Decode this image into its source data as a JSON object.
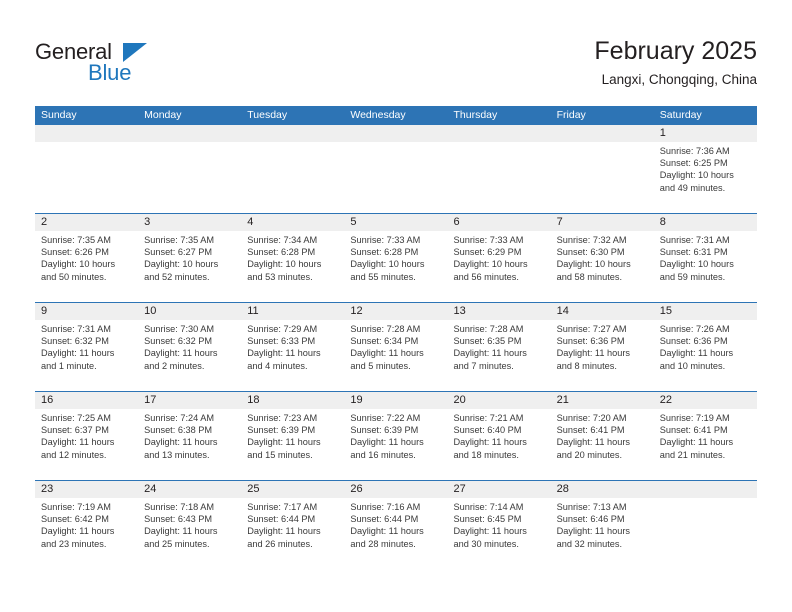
{
  "brand": {
    "name_part1": "General",
    "name_part2": "Blue",
    "accent_color": "#1f77bd"
  },
  "header": {
    "title": "February 2025",
    "subtitle": "Langxi, Chongqing, China"
  },
  "theme": {
    "header_bar": "#2d74b5",
    "daynum_band": "#efefef",
    "text": "#231f20"
  },
  "weekdays": [
    "Sunday",
    "Monday",
    "Tuesday",
    "Wednesday",
    "Thursday",
    "Friday",
    "Saturday"
  ],
  "labels": {
    "sunrise": "Sunrise:",
    "sunset": "Sunset:",
    "daylight": "Daylight:"
  },
  "weeks": [
    [
      {
        "day": "",
        "empty": true
      },
      {
        "day": "",
        "empty": true
      },
      {
        "day": "",
        "empty": true
      },
      {
        "day": "",
        "empty": true
      },
      {
        "day": "",
        "empty": true
      },
      {
        "day": "",
        "empty": true
      },
      {
        "day": "1",
        "sunrise": "Sunrise: 7:36 AM",
        "sunset": "Sunset: 6:25 PM",
        "daylight": "Daylight: 10 hours and 49 minutes."
      }
    ],
    [
      {
        "day": "2",
        "sunrise": "Sunrise: 7:35 AM",
        "sunset": "Sunset: 6:26 PM",
        "daylight": "Daylight: 10 hours and 50 minutes."
      },
      {
        "day": "3",
        "sunrise": "Sunrise: 7:35 AM",
        "sunset": "Sunset: 6:27 PM",
        "daylight": "Daylight: 10 hours and 52 minutes."
      },
      {
        "day": "4",
        "sunrise": "Sunrise: 7:34 AM",
        "sunset": "Sunset: 6:28 PM",
        "daylight": "Daylight: 10 hours and 53 minutes."
      },
      {
        "day": "5",
        "sunrise": "Sunrise: 7:33 AM",
        "sunset": "Sunset: 6:28 PM",
        "daylight": "Daylight: 10 hours and 55 minutes."
      },
      {
        "day": "6",
        "sunrise": "Sunrise: 7:33 AM",
        "sunset": "Sunset: 6:29 PM",
        "daylight": "Daylight: 10 hours and 56 minutes."
      },
      {
        "day": "7",
        "sunrise": "Sunrise: 7:32 AM",
        "sunset": "Sunset: 6:30 PM",
        "daylight": "Daylight: 10 hours and 58 minutes."
      },
      {
        "day": "8",
        "sunrise": "Sunrise: 7:31 AM",
        "sunset": "Sunset: 6:31 PM",
        "daylight": "Daylight: 10 hours and 59 minutes."
      }
    ],
    [
      {
        "day": "9",
        "sunrise": "Sunrise: 7:31 AM",
        "sunset": "Sunset: 6:32 PM",
        "daylight": "Daylight: 11 hours and 1 minute."
      },
      {
        "day": "10",
        "sunrise": "Sunrise: 7:30 AM",
        "sunset": "Sunset: 6:32 PM",
        "daylight": "Daylight: 11 hours and 2 minutes."
      },
      {
        "day": "11",
        "sunrise": "Sunrise: 7:29 AM",
        "sunset": "Sunset: 6:33 PM",
        "daylight": "Daylight: 11 hours and 4 minutes."
      },
      {
        "day": "12",
        "sunrise": "Sunrise: 7:28 AM",
        "sunset": "Sunset: 6:34 PM",
        "daylight": "Daylight: 11 hours and 5 minutes."
      },
      {
        "day": "13",
        "sunrise": "Sunrise: 7:28 AM",
        "sunset": "Sunset: 6:35 PM",
        "daylight": "Daylight: 11 hours and 7 minutes."
      },
      {
        "day": "14",
        "sunrise": "Sunrise: 7:27 AM",
        "sunset": "Sunset: 6:36 PM",
        "daylight": "Daylight: 11 hours and 8 minutes."
      },
      {
        "day": "15",
        "sunrise": "Sunrise: 7:26 AM",
        "sunset": "Sunset: 6:36 PM",
        "daylight": "Daylight: 11 hours and 10 minutes."
      }
    ],
    [
      {
        "day": "16",
        "sunrise": "Sunrise: 7:25 AM",
        "sunset": "Sunset: 6:37 PM",
        "daylight": "Daylight: 11 hours and 12 minutes."
      },
      {
        "day": "17",
        "sunrise": "Sunrise: 7:24 AM",
        "sunset": "Sunset: 6:38 PM",
        "daylight": "Daylight: 11 hours and 13 minutes."
      },
      {
        "day": "18",
        "sunrise": "Sunrise: 7:23 AM",
        "sunset": "Sunset: 6:39 PM",
        "daylight": "Daylight: 11 hours and 15 minutes."
      },
      {
        "day": "19",
        "sunrise": "Sunrise: 7:22 AM",
        "sunset": "Sunset: 6:39 PM",
        "daylight": "Daylight: 11 hours and 16 minutes."
      },
      {
        "day": "20",
        "sunrise": "Sunrise: 7:21 AM",
        "sunset": "Sunset: 6:40 PM",
        "daylight": "Daylight: 11 hours and 18 minutes."
      },
      {
        "day": "21",
        "sunrise": "Sunrise: 7:20 AM",
        "sunset": "Sunset: 6:41 PM",
        "daylight": "Daylight: 11 hours and 20 minutes."
      },
      {
        "day": "22",
        "sunrise": "Sunrise: 7:19 AM",
        "sunset": "Sunset: 6:41 PM",
        "daylight": "Daylight: 11 hours and 21 minutes."
      }
    ],
    [
      {
        "day": "23",
        "sunrise": "Sunrise: 7:19 AM",
        "sunset": "Sunset: 6:42 PM",
        "daylight": "Daylight: 11 hours and 23 minutes."
      },
      {
        "day": "24",
        "sunrise": "Sunrise: 7:18 AM",
        "sunset": "Sunset: 6:43 PM",
        "daylight": "Daylight: 11 hours and 25 minutes."
      },
      {
        "day": "25",
        "sunrise": "Sunrise: 7:17 AM",
        "sunset": "Sunset: 6:44 PM",
        "daylight": "Daylight: 11 hours and 26 minutes."
      },
      {
        "day": "26",
        "sunrise": "Sunrise: 7:16 AM",
        "sunset": "Sunset: 6:44 PM",
        "daylight": "Daylight: 11 hours and 28 minutes."
      },
      {
        "day": "27",
        "sunrise": "Sunrise: 7:14 AM",
        "sunset": "Sunset: 6:45 PM",
        "daylight": "Daylight: 11 hours and 30 minutes."
      },
      {
        "day": "28",
        "sunrise": "Sunrise: 7:13 AM",
        "sunset": "Sunset: 6:46 PM",
        "daylight": "Daylight: 11 hours and 32 minutes."
      },
      {
        "day": "",
        "empty": true
      }
    ]
  ]
}
